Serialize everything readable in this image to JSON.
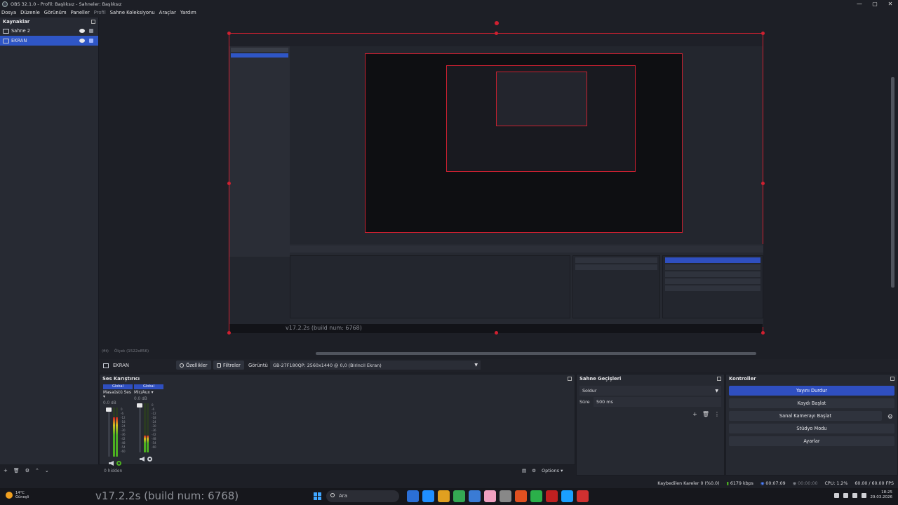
{
  "window": {
    "title": "OBS 32.1.0 - Profil: Başlıksız - Sahneler: Başlıksız",
    "min": "—",
    "max": "▢",
    "close": "✕"
  },
  "menu": [
    "Dosya",
    "Düzenle",
    "Görünüm",
    "Paneller",
    "Profil",
    "Sahne Koleksiyonu",
    "Araçlar",
    "Yardım"
  ],
  "sources": {
    "header": "Kaynaklar",
    "items": [
      {
        "label": "Sahne 2",
        "selected": false
      },
      {
        "label": "EKRAN",
        "selected": true
      }
    ]
  },
  "preview": {
    "inner_version": "v17.2.2s (build num: 6768)",
    "zoom": "(fit)",
    "zoom_label": "Ölçek (1522x856)"
  },
  "source_toolbar": {
    "source_name": "EKRAN",
    "properties": "Özellikler",
    "filters": "Filtreler",
    "display_label": "Görüntü",
    "display_value": "GB-27F180QP: 2560x1440 @ 0,0 (Birincil Ekran)"
  },
  "mixer": {
    "header": "Ses Karıştırıcı",
    "channels": [
      {
        "tag": "Global",
        "name": "Masaüstü Ses",
        "db": "0.0 dB",
        "level": 0.8
      },
      {
        "tag": "Global",
        "name": "Mic/Aux",
        "db": "0.0 dB",
        "level": 0.35
      }
    ],
    "ticks": [
      "0",
      "-6",
      "-12",
      "-18",
      "-24",
      "-30",
      "-36",
      "-42",
      "-48",
      "-54",
      "-60"
    ],
    "hidden": "0 hidden",
    "options": "Options"
  },
  "transitions": {
    "header": "Sahne Geçişleri",
    "type": "Soldur",
    "duration_label": "Süre",
    "duration": "500 ms"
  },
  "controls": {
    "header": "Kontroller",
    "buttons": [
      "Yayını Durdur",
      "Kaydı Başlat",
      "Sanal Kamerayı Başlat",
      "Stüdyo Modu",
      "Ayarlar"
    ]
  },
  "status": {
    "dropped": "Kaybedilen Kareler 0 (%0.0)",
    "bitrate": "6179 kbps",
    "stream_time": "00:07:09",
    "rec_time": "00:00:00",
    "cpu": "CPU: 1.2%",
    "fps": "60.00 / 60.00 FPS"
  },
  "taskbar": {
    "temp": "14°C",
    "weather": "Güneşli",
    "version_overlay": "v17.2.2s (build num: 6768)",
    "search": "Ara",
    "time": "18:25",
    "date": "29.03.2026",
    "app_colors": [
      "#2b6fd6",
      "#1f8fff",
      "#e0a020",
      "#34a853",
      "#3a7bd5",
      "#f0a0c0",
      "#888888",
      "#e05020",
      "#2bb04a",
      "#c02020",
      "#1a9fff",
      "#d03030"
    ]
  }
}
